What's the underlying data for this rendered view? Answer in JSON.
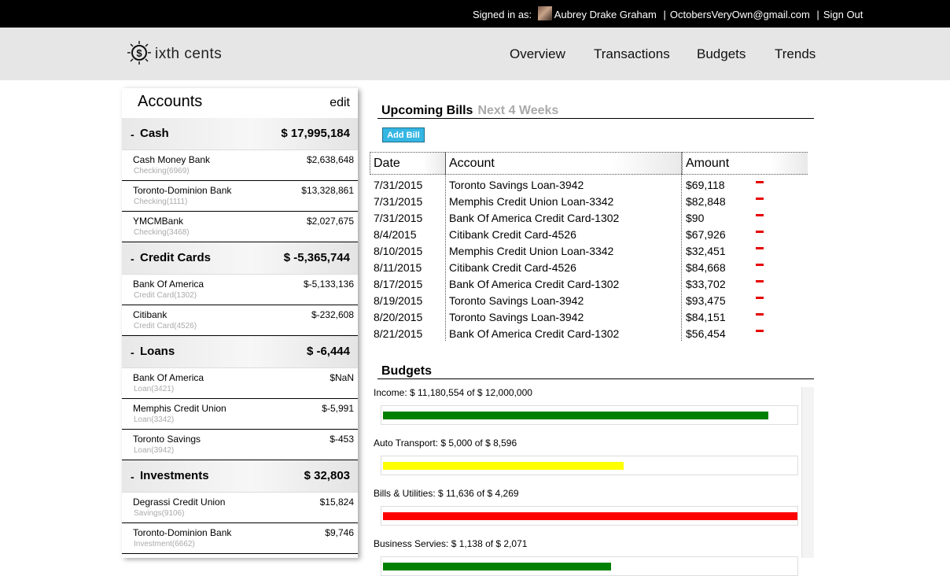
{
  "topbar": {
    "signed_in_label": "Signed in as:",
    "user_name": "Aubrey Drake Graham",
    "email": "OctobersVeryOwn@gmail.com",
    "sign_out": "Sign Out",
    "separator": "|"
  },
  "brand": {
    "logo_text": "ixth cents"
  },
  "nav": [
    "Overview",
    "Transactions",
    "Budgets",
    "Trends"
  ],
  "sidebar": {
    "title": "Accounts",
    "edit_label": "edit",
    "groups": [
      {
        "name": "Cash",
        "total": "$ 17,995,184",
        "accounts": [
          {
            "name": "Cash Money Bank",
            "sub": "Checking(6969)",
            "balance": "$2,638,648"
          },
          {
            "name": "Toronto-Dominion Bank",
            "sub": "Checking(1111)",
            "balance": "$13,328,861"
          },
          {
            "name": "YMCMBank",
            "sub": "Checking(3468)",
            "balance": "$2,027,675"
          }
        ]
      },
      {
        "name": "Credit Cards",
        "total": "$ -5,365,744",
        "accounts": [
          {
            "name": "Bank Of America",
            "sub": "Credit Card(1302)",
            "balance": "$-5,133,136"
          },
          {
            "name": "Citibank",
            "sub": "Credit Card(4526)",
            "balance": "$-232,608"
          }
        ]
      },
      {
        "name": "Loans",
        "total": "$ -6,444",
        "accounts": [
          {
            "name": "Bank Of America",
            "sub": "Loan(3421)",
            "balance": "$NaN"
          },
          {
            "name": "Memphis Credit Union",
            "sub": "Loan(3342)",
            "balance": "$-5,991"
          },
          {
            "name": "Toronto Savings",
            "sub": "Loan(3942)",
            "balance": "$-453"
          }
        ]
      },
      {
        "name": "Investments",
        "total": "$ 32,803",
        "accounts": [
          {
            "name": "Degrassi Credit Union",
            "sub": "Savings(9106)",
            "balance": "$15,824"
          },
          {
            "name": "Toronto-Dominion Bank",
            "sub": "Investment(6662)",
            "balance": "$9,746"
          }
        ]
      }
    ]
  },
  "bills": {
    "title": "Upcoming Bills",
    "subtitle": "Next 4 Weeks",
    "add_label": "Add Bill",
    "columns": [
      "Date",
      "Account",
      "Amount"
    ],
    "rows": [
      {
        "date": "7/31/2015",
        "account": "Toronto Savings Loan-3942",
        "amount": "$69,118"
      },
      {
        "date": "7/31/2015",
        "account": "Memphis Credit Union Loan-3342",
        "amount": "$82,848"
      },
      {
        "date": "7/31/2015",
        "account": "Bank Of America Credit Card-1302",
        "amount": "$90"
      },
      {
        "date": "8/4/2015",
        "account": "Citibank Credit Card-4526",
        "amount": "$67,926"
      },
      {
        "date": "8/10/2015",
        "account": "Memphis Credit Union Loan-3342",
        "amount": "$32,451"
      },
      {
        "date": "8/11/2015",
        "account": "Citibank Credit Card-4526",
        "amount": "$84,668"
      },
      {
        "date": "8/17/2015",
        "account": "Bank Of America Credit Card-1302",
        "amount": "$33,702"
      },
      {
        "date": "8/19/2015",
        "account": "Toronto Savings Loan-3942",
        "amount": "$93,475"
      },
      {
        "date": "8/20/2015",
        "account": "Toronto Savings Loan-3942",
        "amount": "$84,151"
      },
      {
        "date": "8/21/2015",
        "account": "Bank Of America Credit Card-1302",
        "amount": "$56,454"
      }
    ],
    "remove_color": "#e60000"
  },
  "budgets": {
    "title": "Budgets",
    "items": [
      {
        "label": "Income: $ 11,180,554 of $ 12,000,000",
        "fraction": 0.93,
        "color": "#008000"
      },
      {
        "label": "Auto Transport: $ 5,000 of $ 8,596",
        "fraction": 0.58,
        "color": "#ffff00"
      },
      {
        "label": "Bills & Utilities: $ 11,636 of $ 4,269",
        "fraction": 1.0,
        "color": "#ff0000"
      },
      {
        "label": "Business Servies: $ 1,138 of $ 2,071",
        "fraction": 0.55,
        "color": "#008000"
      }
    ]
  },
  "colors": {
    "add_button": "#35b6e3",
    "header_bg": "#e6e6e6",
    "topbar_bg": "#000000"
  }
}
